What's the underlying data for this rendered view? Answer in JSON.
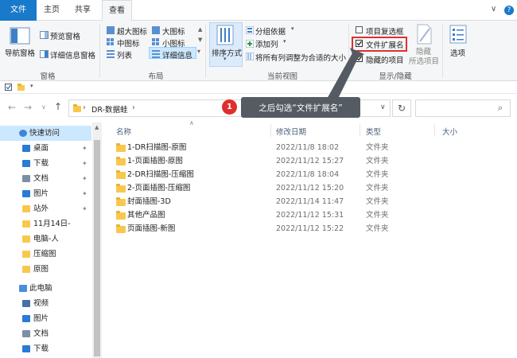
{
  "tabs": {
    "file": "文件",
    "home": "主页",
    "share": "共享",
    "view": "查看"
  },
  "window_controls": {
    "collapse": "∨",
    "help": "?"
  },
  "ribbon": {
    "panes": {
      "nav_pane": "导航窗格",
      "preview_pane": "预览窗格",
      "details_pane": "详细信息窗格",
      "label": "窗格"
    },
    "layout": {
      "extra_large": "超大图标",
      "large": "大图标",
      "medium": "中图标",
      "small": "小图标",
      "list": "列表",
      "details": "详细信息",
      "label": "布局"
    },
    "current_view": {
      "sort_by": "排序方式",
      "group_by": "分组依据",
      "add_column": "添加列",
      "fit_columns": "将所有列调整为合适的大小",
      "label": "当前视图"
    },
    "show_hide": {
      "item_checkboxes": "项目复选框",
      "file_extensions": "文件扩展名",
      "hidden_items": "隐藏的项目",
      "hide": "隐藏",
      "selected_items": "所选项目",
      "label": "显示/隐藏"
    },
    "options": "选项"
  },
  "address": {
    "path": "DR-数据蛙",
    "separator": "›",
    "placeholder": ""
  },
  "callout": {
    "number": "1",
    "text": "之后勾选“文件扩展名”"
  },
  "nav_pane": {
    "items": [
      {
        "label": "快速访问",
        "icon": "star-icon",
        "selected": true,
        "pin": false
      },
      {
        "label": "桌面",
        "icon": "desktop-icon",
        "pin": true
      },
      {
        "label": "下载",
        "icon": "download-icon",
        "pin": true
      },
      {
        "label": "文档",
        "icon": "document-icon",
        "pin": true
      },
      {
        "label": "图片",
        "icon": "picture-icon",
        "pin": true
      },
      {
        "label": "站外",
        "icon": "folder-icon",
        "pin": true
      },
      {
        "label": "11月14日-",
        "icon": "folder-icon",
        "pin": false
      },
      {
        "label": "电脑-人",
        "icon": "folder-icon",
        "pin": false
      },
      {
        "label": "压缩图",
        "icon": "folder-icon",
        "pin": false
      },
      {
        "label": "原图",
        "icon": "folder-icon",
        "pin": false
      },
      {
        "label": "此电脑",
        "icon": "computer-icon",
        "pin": false
      },
      {
        "label": "视频",
        "icon": "video-icon",
        "pin": false
      },
      {
        "label": "图片",
        "icon": "picture-icon",
        "pin": false
      },
      {
        "label": "文档",
        "icon": "document-icon",
        "pin": false
      },
      {
        "label": "下载",
        "icon": "download-icon",
        "pin": false
      }
    ]
  },
  "columns": {
    "name": "名称",
    "modified": "修改日期",
    "type": "类型",
    "size": "大小"
  },
  "files": [
    {
      "name": "1-DR扫描图-原图",
      "modified": "2022/11/8 18:02",
      "type": "文件夹"
    },
    {
      "name": "1-页面插图-原图",
      "modified": "2022/11/12 15:27",
      "type": "文件夹"
    },
    {
      "name": "2-DR扫描图-压缩图",
      "modified": "2022/11/8 18:04",
      "type": "文件夹"
    },
    {
      "name": "2-页面插图-压缩图",
      "modified": "2022/11/12 15:20",
      "type": "文件夹"
    },
    {
      "name": "封面插图-3D",
      "modified": "2022/11/14 11:47",
      "type": "文件夹"
    },
    {
      "name": "其他产品图",
      "modified": "2022/11/12 15:31",
      "type": "文件夹"
    },
    {
      "name": "页面插图-新图",
      "modified": "2022/11/12 15:22",
      "type": "文件夹"
    }
  ],
  "colors": {
    "accent": "#1979ca",
    "highlight": "#e0302f",
    "folder": "#f8c84e"
  }
}
